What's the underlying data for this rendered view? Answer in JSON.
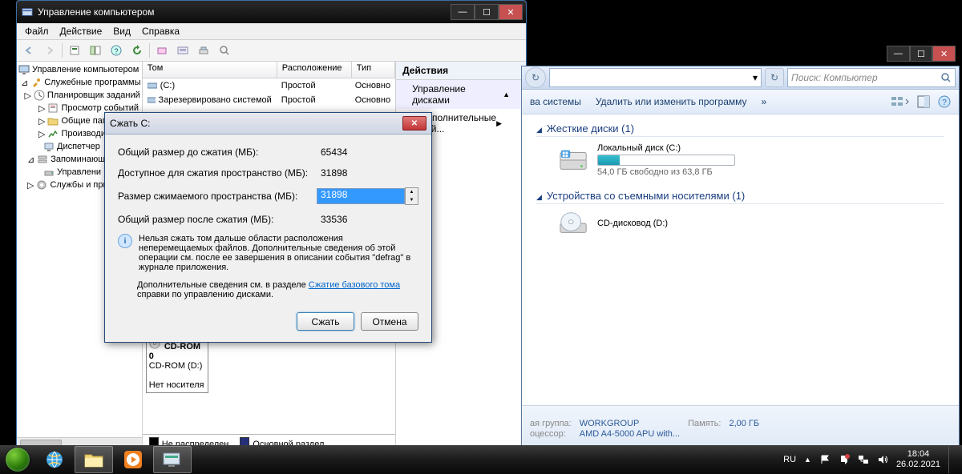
{
  "mgmt": {
    "title": "Управление компьютером",
    "menu": {
      "file": "Файл",
      "action": "Действие",
      "view": "Вид",
      "help": "Справка"
    },
    "tree": {
      "root": "Управление компьютером (л",
      "tools": "Служебные программы",
      "sched": "Планировщик заданий",
      "event": "Просмотр событий",
      "shared": "Общие пап",
      "perf": "Производи",
      "devmgr": "Диспетчер",
      "storage": "Запоминающ",
      "diskm": "Управлени",
      "services": "Службы и при"
    },
    "list": {
      "head": {
        "name": "Том",
        "layout": "Расположение",
        "type": "Тип"
      },
      "rows": [
        {
          "name": "(C:)",
          "layout": "Простой",
          "type": "Основно"
        },
        {
          "name": "Зарезервировано системой",
          "layout": "Простой",
          "type": "Основно"
        }
      ]
    },
    "actions": {
      "head": "Действия",
      "group": "Управление дисками",
      "more": "Дополнительные дей..."
    },
    "lower": {
      "cd": "CD-ROM 0",
      "cdlabel": "CD-ROM (D:)",
      "nomedia": "Нет носителя"
    },
    "legend": {
      "unalloc": "Не распределен",
      "primary": "Основной раздел"
    }
  },
  "dlg": {
    "title": "Сжать C:",
    "rows": {
      "total_before_l": "Общий размер до сжатия (МБ):",
      "total_before_v": "65434",
      "avail_l": "Доступное для сжатия пространство (МБ):",
      "avail_v": "31898",
      "shrink_l": "Размер сжимаемого пространства (МБ):",
      "shrink_v": "31898",
      "total_after_l": "Общий размер после сжатия (МБ):",
      "total_after_v": "33536"
    },
    "info": "Нельзя сжать том дальше области расположения неперемещаемых файлов. Дополнительные сведения об этой операции см. после ее завершения в описании события \"defrag\" в журнале приложения.",
    "more_pre": "Дополнительные сведения см. в разделе ",
    "more_link": "Сжатие базового тома",
    "more_post": " справки по управлению дисками.",
    "btn_ok": "Сжать",
    "btn_cancel": "Отмена"
  },
  "explorer": {
    "search_ph": "Поиск: Компьютер",
    "cmd": {
      "sysprop": "ва системы",
      "uninstall": "Удалить или изменить программу"
    },
    "hdd_head": "Жесткие диски (1)",
    "drive_c": {
      "label": "Локальный диск (C:)",
      "free": "54,0 ГБ свободно из 63,8 ГБ",
      "fill_pct": 16
    },
    "rem_head": "Устройства со съемными носителями (1)",
    "drive_d": {
      "label": "CD-дисковод (D:)"
    },
    "details": {
      "wg_l": "ая группа:",
      "wg_v": "WORKGROUP",
      "cpu_l": "оцессор:",
      "cpu_v": "AMD A4-5000 APU with...",
      "mem_l": "Память:",
      "mem_v": "2,00 ГБ"
    }
  },
  "tray": {
    "lang": "RU",
    "time": "18:04",
    "date": "26.02.2021"
  }
}
